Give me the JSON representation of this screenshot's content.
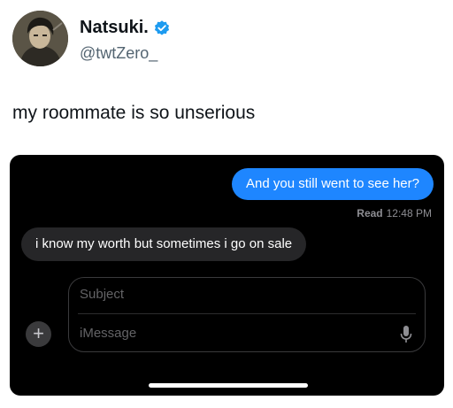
{
  "tweet": {
    "display_name": "Natsuki.",
    "handle": "@twtZero_",
    "verified": true,
    "text": "my roommate is so unserious",
    "colors": {
      "verified_badge": "#1d9bf0",
      "name_text": "#0f1419",
      "handle_text": "#536471"
    }
  },
  "conversation": {
    "messages": [
      {
        "direction": "sent",
        "text": "And you still went to see her?"
      },
      {
        "direction": "received",
        "text": "i know my worth but sometimes i go on sale"
      }
    ],
    "read_receipt": {
      "label": "Read",
      "time": "12:48 PM"
    },
    "compose": {
      "subject_placeholder": "Subject",
      "message_placeholder": "iMessage"
    },
    "icons": {
      "plus": "plus-icon",
      "mic": "microphone-icon"
    },
    "colors": {
      "background": "#000000",
      "sent_bubble": "#1e86ff",
      "received_bubble": "#262628"
    }
  }
}
